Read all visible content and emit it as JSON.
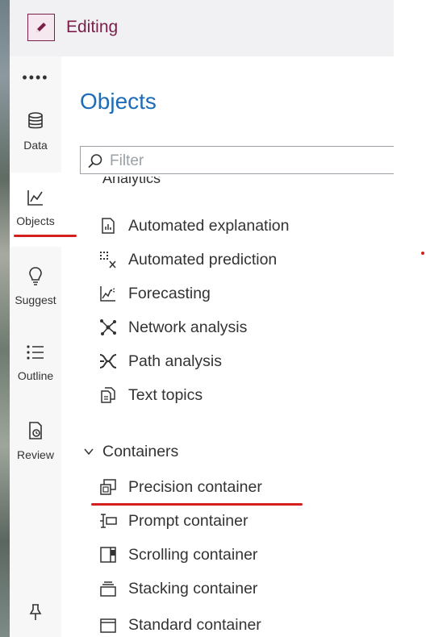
{
  "header": {
    "mode_label": "Editing",
    "accent": "#7b1f4a"
  },
  "rail": {
    "more_label": "••••",
    "items": [
      {
        "label": "Data",
        "icon": "database-icon"
      },
      {
        "label": "Objects",
        "icon": "line-chart-icon"
      },
      {
        "label": "Suggest",
        "icon": "lightbulb-icon"
      },
      {
        "label": "Outline",
        "icon": "list-icon"
      },
      {
        "label": "Review",
        "icon": "review-document-icon"
      }
    ],
    "pin_icon": "pin-icon",
    "active": "Objects"
  },
  "panel": {
    "title": "Objects",
    "title_color": "#1e6cb7",
    "filter": {
      "placeholder": "Filter",
      "value": ""
    },
    "analytics": {
      "cut_label": "Analytics",
      "items": [
        {
          "label": "Automated explanation",
          "icon": "automated-explanation-icon"
        },
        {
          "label": "Automated prediction",
          "icon": "automated-prediction-icon"
        },
        {
          "label": "Forecasting",
          "icon": "forecasting-icon"
        },
        {
          "label": "Network analysis",
          "icon": "network-analysis-icon"
        },
        {
          "label": "Path analysis",
          "icon": "path-analysis-icon"
        },
        {
          "label": "Text topics",
          "icon": "text-topics-icon"
        }
      ]
    },
    "containers": {
      "label": "Containers",
      "expanded": true,
      "items": [
        {
          "label": "Precision container",
          "icon": "precision-container-icon"
        },
        {
          "label": "Prompt container",
          "icon": "prompt-container-icon"
        },
        {
          "label": "Scrolling container",
          "icon": "scrolling-container-icon"
        },
        {
          "label": "Stacking container",
          "icon": "stacking-container-icon"
        },
        {
          "label": "Standard container",
          "icon": "standard-container-icon"
        }
      ]
    }
  },
  "annotation_color": "#d41f1f"
}
